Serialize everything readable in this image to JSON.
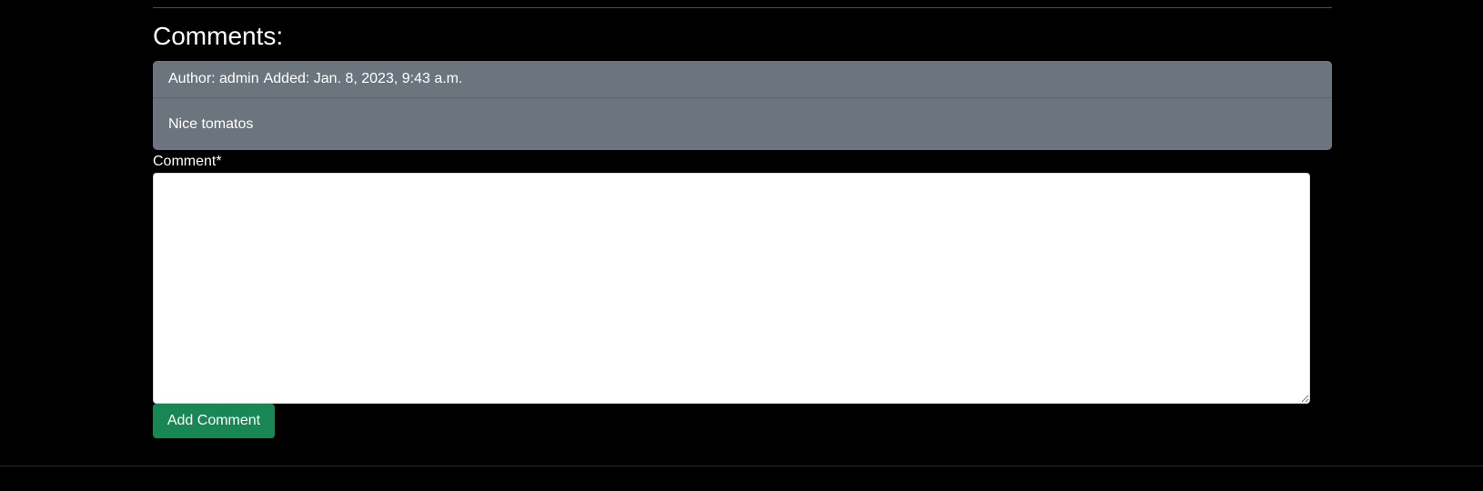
{
  "comments_section": {
    "heading": "Comments:",
    "comments": [
      {
        "author_text": "Author: admin",
        "added_text": "Added: Jan. 8, 2023, 9:43 a.m.",
        "body": "Nice tomatos"
      }
    ]
  },
  "comment_form": {
    "label": "Comment*",
    "value": "",
    "submit_label": "Add Comment"
  },
  "colors": {
    "background": "#000000",
    "card": "#6c757d",
    "submit_button": "#198754"
  }
}
